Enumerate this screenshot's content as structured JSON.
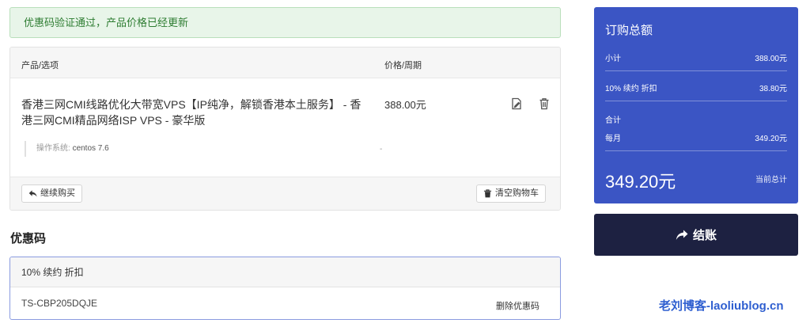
{
  "alert": {
    "message": "优惠码验证通过，产品价格已经更新"
  },
  "cart": {
    "columns": {
      "product": "产品/选项",
      "price": "价格/周期"
    },
    "item": {
      "name": "香港三网CMI线路优化大带宽VPS【IP纯净，解锁香港本土服务】 - 香港三网CMI精品网络ISP VPS - 豪华版",
      "price": "388.00元",
      "option_label": "操作系统:",
      "option_value": "centos 7.6",
      "option_price": "-"
    },
    "continue_label": "继续购买",
    "empty_label": "清空购物车"
  },
  "promo": {
    "title": "优惠码",
    "description": "10% 续约 折扣",
    "code": "TS-CBP205DQJE",
    "remove_label": "删除优惠码"
  },
  "summary": {
    "title": "订购总额",
    "subtotal_label": "小计",
    "subtotal_value": "388.00元",
    "discount_label": "10% 续约 折扣",
    "discount_value": "38.80元",
    "total_section_label": "合计",
    "cycle_label": "每月",
    "cycle_value": "349.20元",
    "total_value": "349.20元",
    "total_caption": "当前总计"
  },
  "checkout": {
    "label": "结账"
  },
  "watermark": {
    "text": "老刘博客-laoliublog.cn"
  },
  "colors": {
    "summary_bg": "#3b55c4",
    "checkout_bg": "#1d2141",
    "alert_text": "#2e7d32",
    "watermark": "#2f5fd0"
  }
}
